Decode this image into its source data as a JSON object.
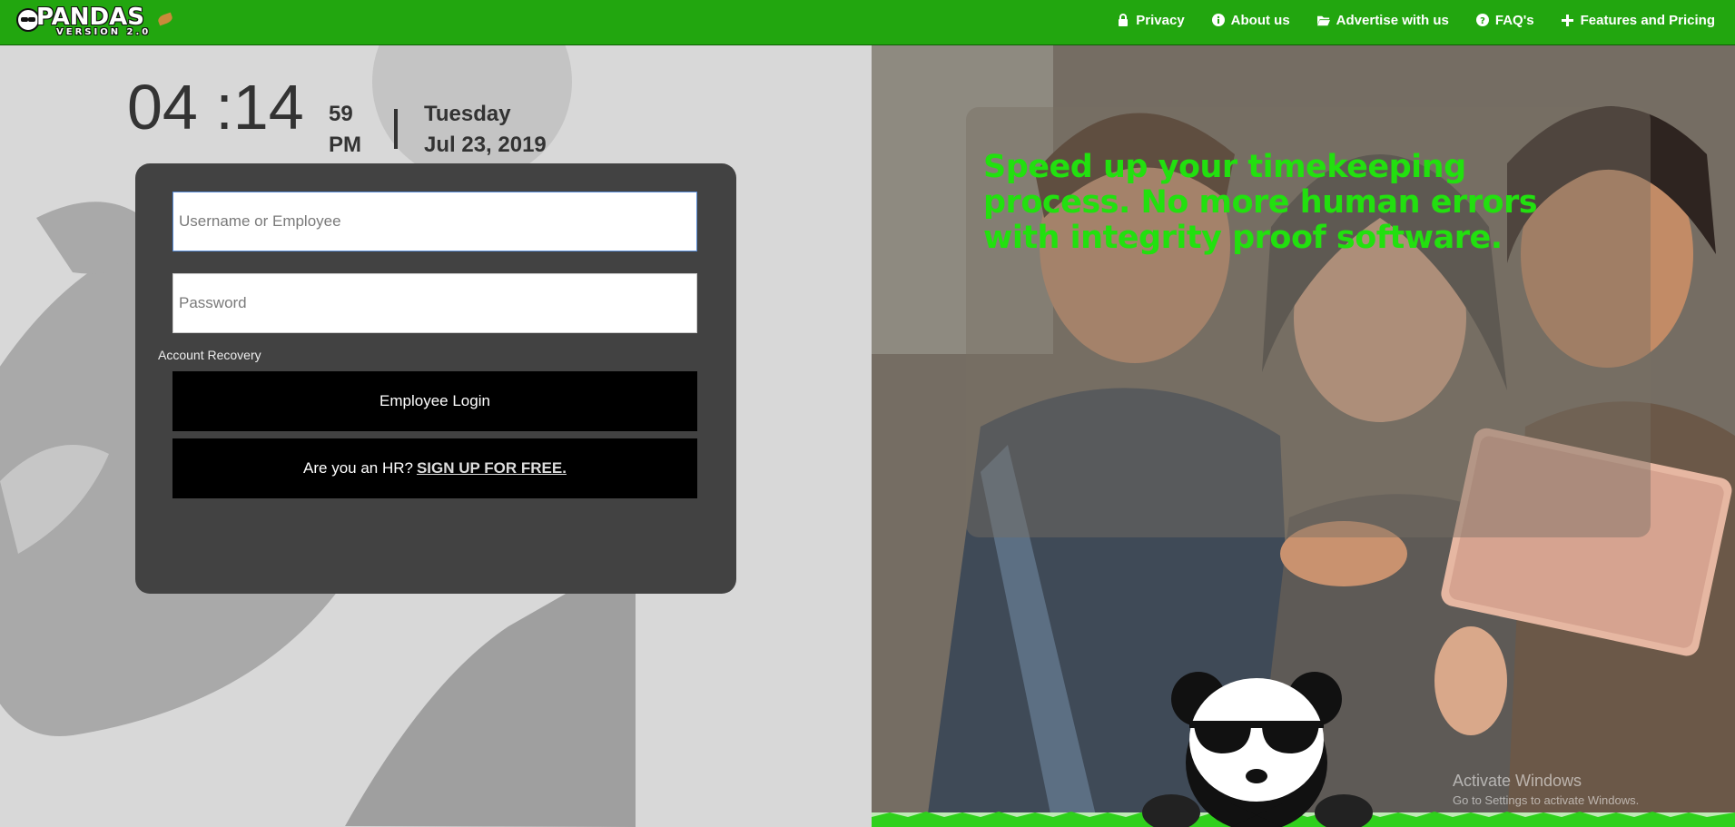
{
  "brand": {
    "name": "PANDAS",
    "version": "VERSION 2.0"
  },
  "nav": [
    {
      "label": "Privacy",
      "icon": "lock-icon"
    },
    {
      "label": "About us",
      "icon": "info-icon"
    },
    {
      "label": "Advertise with us",
      "icon": "folder-open-icon"
    },
    {
      "label": "FAQ's",
      "icon": "question-icon"
    },
    {
      "label": "Features and Pricing",
      "icon": "plus-icon"
    }
  ],
  "clock": {
    "hours": "04",
    "minutes": "14",
    "seconds": "59",
    "ampm": "PM",
    "day": "Tuesday",
    "date": "Jul 23, 2019"
  },
  "login": {
    "username_placeholder": "Username or Employee",
    "password_placeholder": "Password",
    "recovery_label": "Account Recovery",
    "login_button": "Employee Login",
    "signup_prefix": "Are you an HR?",
    "signup_link": "SIGN UP FOR FREE."
  },
  "hero": {
    "headline": "Speed up your timekeeping process. No more human errors with integrity proof software."
  },
  "watermark": {
    "line1": "Activate Windows",
    "line2": "Go to Settings to activate Windows."
  },
  "colors": {
    "topbar": "#22a60f",
    "headline": "#22e00f",
    "card": "#424242",
    "button": "#000000"
  }
}
